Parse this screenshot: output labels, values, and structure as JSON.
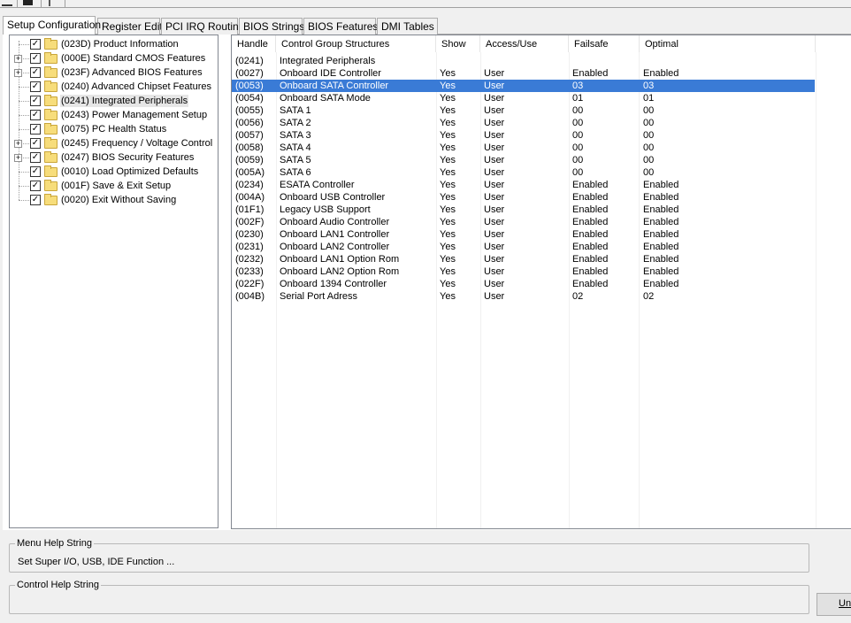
{
  "tabs": [
    {
      "label": "Setup Configuration",
      "active": true
    },
    {
      "label": "Register Edit"
    },
    {
      "label": "PCI IRQ Routing"
    },
    {
      "label": "BIOS Strings"
    },
    {
      "label": "BIOS Features"
    },
    {
      "label": "DMI Tables"
    }
  ],
  "tree": [
    {
      "label": "(023D) Product Information",
      "expandable": false
    },
    {
      "label": "(000E) Standard CMOS Features",
      "expandable": true
    },
    {
      "label": "(023F) Advanced BIOS Features",
      "expandable": true
    },
    {
      "label": "(0240) Advanced Chipset Features",
      "expandable": false
    },
    {
      "label": "(0241) Integrated Peripherals",
      "expandable": false,
      "selected": true
    },
    {
      "label": "(0243) Power Management Setup",
      "expandable": false
    },
    {
      "label": "(0075) PC Health Status",
      "expandable": false
    },
    {
      "label": "(0245) Frequency / Voltage Control",
      "expandable": true
    },
    {
      "label": "(0247) BIOS Security Features",
      "expandable": true
    },
    {
      "label": "(0010) Load Optimized Defaults",
      "expandable": false
    },
    {
      "label": "(001F) Save & Exit Setup",
      "expandable": false
    },
    {
      "label": "(0020) Exit Without Saving",
      "expandable": false
    }
  ],
  "columns": [
    "Handle",
    "Control Group Structures",
    "Show",
    "Access/Use",
    "Failsafe",
    "Optimal"
  ],
  "rows": [
    [
      "(0241)",
      "Integrated Peripherals",
      "",
      "",
      "",
      ""
    ],
    [
      "(0027)",
      "Onboard IDE Controller",
      "Yes",
      "User",
      "Enabled",
      "Enabled"
    ],
    [
      "(0053)",
      "Onboard SATA Controller",
      "Yes",
      "User",
      "03",
      "03"
    ],
    [
      "(0054)",
      "Onboard SATA Mode",
      "Yes",
      "User",
      "01",
      "01"
    ],
    [
      "(0055)",
      "SATA 1",
      "Yes",
      "User",
      "00",
      "00"
    ],
    [
      "(0056)",
      "SATA 2",
      "Yes",
      "User",
      "00",
      "00"
    ],
    [
      "(0057)",
      "SATA 3",
      "Yes",
      "User",
      "00",
      "00"
    ],
    [
      "(0058)",
      "SATA 4",
      "Yes",
      "User",
      "00",
      "00"
    ],
    [
      "(0059)",
      "SATA 5",
      "Yes",
      "User",
      "00",
      "00"
    ],
    [
      "(005A)",
      "SATA 6",
      "Yes",
      "User",
      "00",
      "00"
    ],
    [
      "(0234)",
      "ESATA Controller",
      "Yes",
      "User",
      "Enabled",
      "Enabled"
    ],
    [
      "(004A)",
      "Onboard USB Controller",
      "Yes",
      "User",
      "Enabled",
      "Enabled"
    ],
    [
      "(01F1)",
      "Legacy USB Support",
      "Yes",
      "User",
      "Enabled",
      "Enabled"
    ],
    [
      "(002F)",
      "Onboard Audio Controller",
      "Yes",
      "User",
      "Enabled",
      "Enabled"
    ],
    [
      "(0230)",
      "Onboard LAN1 Controller",
      "Yes",
      "User",
      "Enabled",
      "Enabled"
    ],
    [
      "(0231)",
      "Onboard LAN2 Controller",
      "Yes",
      "User",
      "Enabled",
      "Enabled"
    ],
    [
      "(0232)",
      "Onboard LAN1 Option Rom",
      "Yes",
      "User",
      "Enabled",
      "Enabled"
    ],
    [
      "(0233)",
      "Onboard LAN2 Option Rom",
      "Yes",
      "User",
      "Enabled",
      "Enabled"
    ],
    [
      "(022F)",
      "Onboard 1394 Controller",
      "Yes",
      "User",
      "Enabled",
      "Enabled"
    ],
    [
      "(004B)",
      "Serial Port Adress",
      "Yes",
      "User",
      "02",
      "02"
    ]
  ],
  "selected_row": 2,
  "menu_help": {
    "legend": "Menu Help String",
    "text": "Set Super I/O, USB, IDE Function ..."
  },
  "control_help": {
    "legend": "Control Help String",
    "text": ""
  },
  "undo_button": {
    "underlined": "Un",
    "rest": "do"
  },
  "colors": {
    "selection": "#3a7bd6"
  }
}
